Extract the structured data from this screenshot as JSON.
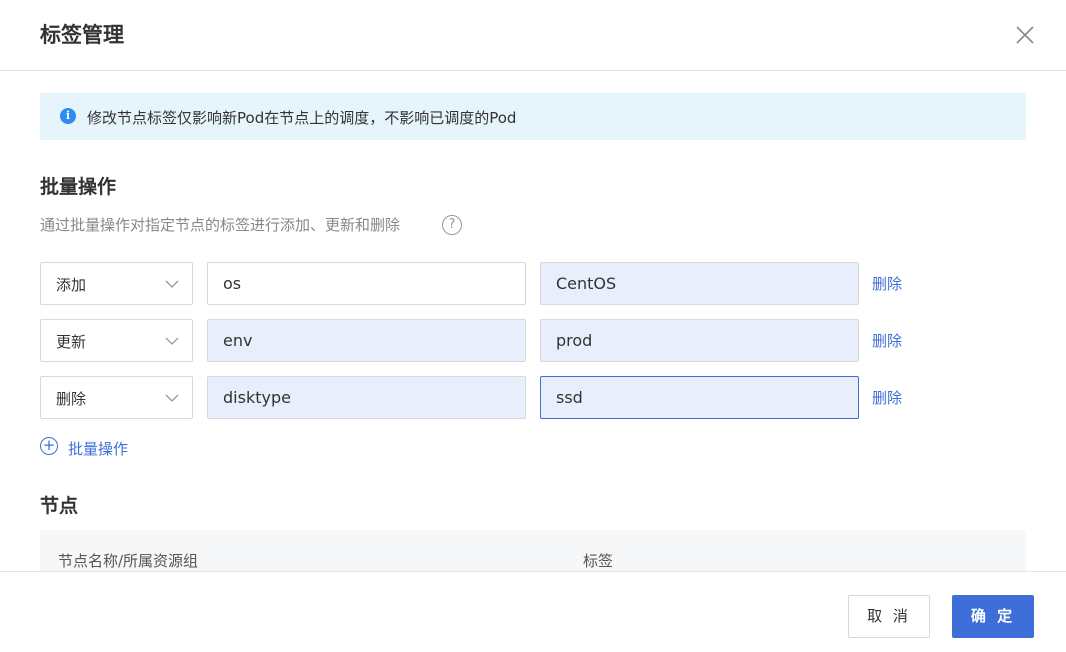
{
  "dialog": {
    "title": "标签管理"
  },
  "notice": {
    "text": "修改节点标签仅影响新Pod在节点上的调度，不影响已调度的Pod"
  },
  "batch": {
    "title": "批量操作",
    "description": "通过批量操作对指定节点的标签进行添加、更新和删除",
    "rows": [
      {
        "action": "添加",
        "key": "os",
        "value": "CentOS",
        "delete_label": "删除"
      },
      {
        "action": "更新",
        "key": "env",
        "value": "prod",
        "delete_label": "删除"
      },
      {
        "action": "删除",
        "key": "disktype",
        "value": "ssd",
        "delete_label": "删除"
      }
    ],
    "add_label": "批量操作"
  },
  "nodes": {
    "title": "节点",
    "columns": [
      "节点名称/所属资源组",
      "标签"
    ]
  },
  "footer": {
    "cancel_label": "取 消",
    "ok_label": "确 定"
  },
  "icons": {
    "close": "close-icon",
    "info": "info-icon",
    "help": "help-icon",
    "chevron": "chevron-down-icon",
    "plus": "plus-circle-icon"
  },
  "colors": {
    "accent": "#3e6fd8",
    "notice_bg": "#e6f4fc",
    "filled_input_bg": "#e8eefc"
  }
}
